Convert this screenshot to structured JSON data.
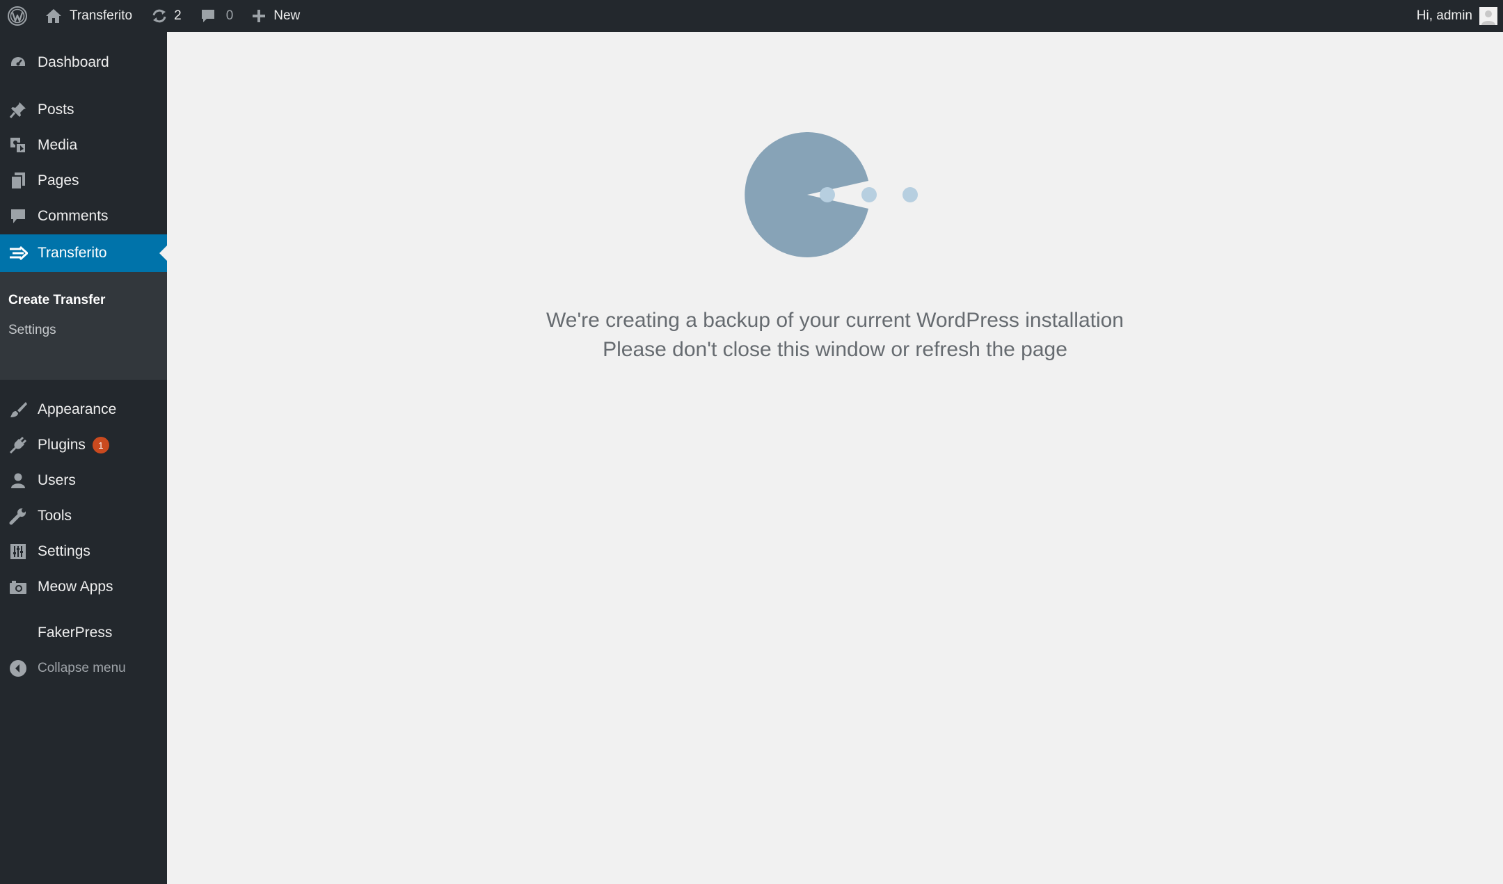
{
  "adminbar": {
    "site_name": "Transferito",
    "updates_count": "2",
    "comments_count": "0",
    "new_label": "New",
    "greeting": "Hi, admin"
  },
  "sidebar": {
    "items": [
      {
        "label": "Dashboard",
        "icon": "dashboard-icon"
      },
      {
        "label": "Posts",
        "icon": "pin-icon"
      },
      {
        "label": "Media",
        "icon": "media-icon"
      },
      {
        "label": "Pages",
        "icon": "pages-icon"
      },
      {
        "label": "Comments",
        "icon": "comment-icon"
      },
      {
        "label": "Transferito",
        "icon": "transfer-arrows-icon",
        "active": true
      },
      {
        "label": "Appearance",
        "icon": "paintbrush-icon"
      },
      {
        "label": "Plugins",
        "icon": "plugin-icon",
        "badge": "1"
      },
      {
        "label": "Users",
        "icon": "user-icon"
      },
      {
        "label": "Tools",
        "icon": "wrench-icon"
      },
      {
        "label": "Settings",
        "icon": "settings-sliders-icon"
      },
      {
        "label": "Meow Apps",
        "icon": "camera-icon"
      },
      {
        "label": "FakerPress",
        "icon": ""
      },
      {
        "label": "Collapse menu",
        "icon": "collapse-icon"
      }
    ],
    "submenu": [
      {
        "label": "Create Transfer",
        "current": true
      },
      {
        "label": "Settings",
        "current": false
      }
    ]
  },
  "main": {
    "message_line1": "We're creating a backup of your current WordPress installation",
    "message_line2": "Please don't close this window or refresh the page"
  },
  "colors": {
    "admin_bar": "#23282d",
    "active_menu": "#0073aa",
    "submenu_bg": "#32373c",
    "badge": "#ca4a1f",
    "content_bg": "#f1f1f1",
    "loader_body": "#87a3b7",
    "loader_dots": "#b7cfe0"
  }
}
